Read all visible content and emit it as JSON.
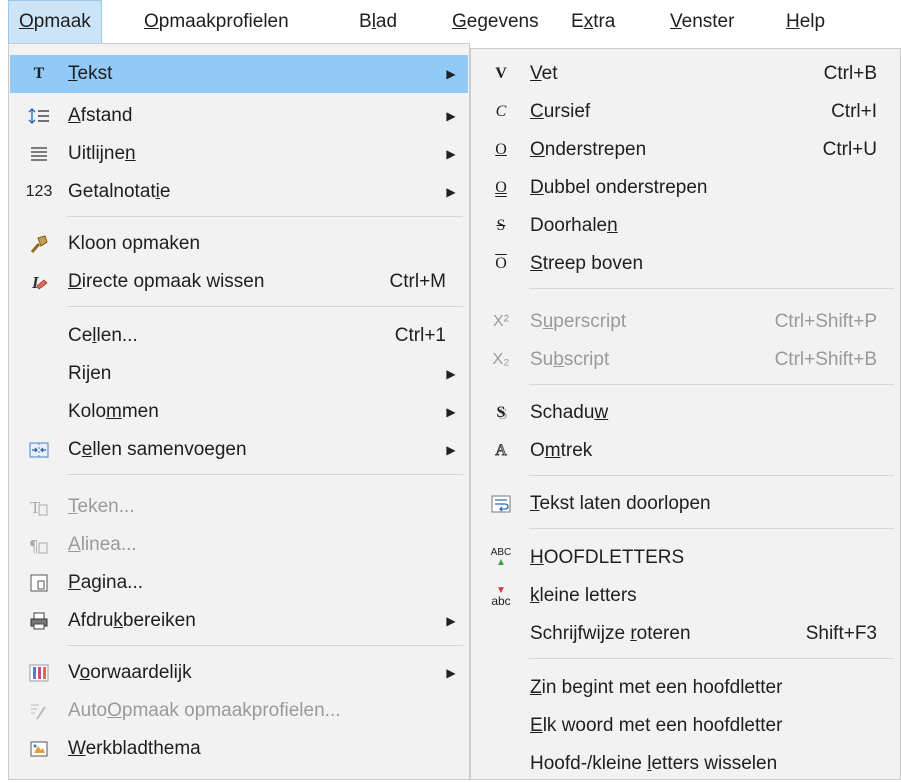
{
  "menubar": {
    "items": [
      {
        "pre": "",
        "u": "O",
        "post": "pmaak"
      },
      {
        "pre": "",
        "u": "O",
        "post": "pmaakprofielen"
      },
      {
        "pre": "B",
        "u": "l",
        "post": "ad"
      },
      {
        "pre": "",
        "u": "G",
        "post": "egevens"
      },
      {
        "pre": "E",
        "u": "x",
        "post": "tra"
      },
      {
        "pre": "",
        "u": "V",
        "post": "enster"
      },
      {
        "pre": "",
        "u": "H",
        "post": "elp"
      }
    ]
  },
  "main_menu": {
    "tekst": {
      "pre": "",
      "u": "T",
      "post": "ekst"
    },
    "afstand": {
      "pre": "",
      "u": "A",
      "post": "fstand"
    },
    "uitlijnen": {
      "pre": "Uitlijne",
      "u": "n",
      "post": ""
    },
    "getalnotatie": {
      "pre": "Getalnotat",
      "u": "i",
      "post": "e",
      "icon": "123"
    },
    "kloon": {
      "pre": "",
      "u": "",
      "post": "Kloon opmaken"
    },
    "directe": {
      "pre": "",
      "u": "D",
      "post": "irecte opmaak wissen",
      "shortcut": "Ctrl+M"
    },
    "cellen": {
      "pre": "Ce",
      "u": "l",
      "post": "len...",
      "shortcut": "Ctrl+1"
    },
    "rijen": {
      "pre": "Ri",
      "u": "j",
      "post": "en"
    },
    "kolommen": {
      "pre": "Kolo",
      "u": "m",
      "post": "men"
    },
    "samenvoegen": {
      "pre": "C",
      "u": "e",
      "post": "llen samenvoegen"
    },
    "teken": {
      "pre": "",
      "u": "T",
      "post": "eken..."
    },
    "alinea": {
      "pre": "",
      "u": "A",
      "post": "linea..."
    },
    "pagina": {
      "pre": "",
      "u": "P",
      "post": "agina..."
    },
    "afdruk": {
      "pre": "Afdru",
      "u": "k",
      "post": "bereiken"
    },
    "voorwaardelijk": {
      "pre": "V",
      "u": "o",
      "post": "orwaardelijk"
    },
    "autoopmaak": {
      "pre": "Auto",
      "u": "O",
      "post": "pmaak opmaakprofielen..."
    },
    "thema": {
      "pre": "",
      "u": "W",
      "post": "erkbladthema"
    }
  },
  "sub_menu": {
    "vet": {
      "pre": "",
      "u": "V",
      "post": "et",
      "shortcut": "Ctrl+B",
      "icon": "V"
    },
    "cursief": {
      "pre": "",
      "u": "C",
      "post": "ursief",
      "shortcut": "Ctrl+I",
      "icon": "C"
    },
    "onderstrepen": {
      "pre": "",
      "u": "O",
      "post": "nderstrepen",
      "shortcut": "Ctrl+U",
      "icon": "O"
    },
    "dubbel": {
      "pre": "",
      "u": "D",
      "post": "ubbel onderstrepen",
      "icon": "O"
    },
    "doorhalen": {
      "pre": "Doorhale",
      "u": "n",
      "post": "",
      "icon": "S"
    },
    "streep": {
      "pre": "",
      "u": "S",
      "post": "treep boven",
      "icon": "O"
    },
    "superscript": {
      "pre": "S",
      "u": "u",
      "post": "perscript",
      "shortcut": "Ctrl+Shift+P",
      "icon": "X²"
    },
    "subscript": {
      "pre": "Su",
      "u": "b",
      "post": "script",
      "shortcut": "Ctrl+Shift+B",
      "icon": "X₂"
    },
    "schaduw": {
      "pre": "Schadu",
      "u": "w",
      "post": "",
      "icon": "S"
    },
    "omtrek": {
      "pre": "O",
      "u": "m",
      "post": "trek",
      "icon": "A"
    },
    "doorlopen": {
      "pre": "",
      "u": "T",
      "post": "ekst laten doorlopen"
    },
    "hoofdletters": {
      "pre": "",
      "u": "H",
      "post": "OOFDLETTERS",
      "icon": "ABC"
    },
    "kleine": {
      "pre": "",
      "u": "k",
      "post": "leine letters",
      "icon": "abc"
    },
    "roteren": {
      "pre": "Schrijfwijze ",
      "u": "r",
      "post": "oteren",
      "shortcut": "Shift+F3"
    },
    "zin": {
      "pre": "",
      "u": "Z",
      "post": "in begint met een hoofdletter"
    },
    "elk": {
      "pre": "",
      "u": "E",
      "post": "lk woord met een hoofdletter"
    },
    "wisselen": {
      "pre": "Hoofd-/kleine ",
      "u": "l",
      "post": "etters wisselen"
    }
  },
  "colors": {
    "highlight": "#91c9f7",
    "menu_bg": "#f2f2f2",
    "active_menubar": "#cce4f7"
  }
}
